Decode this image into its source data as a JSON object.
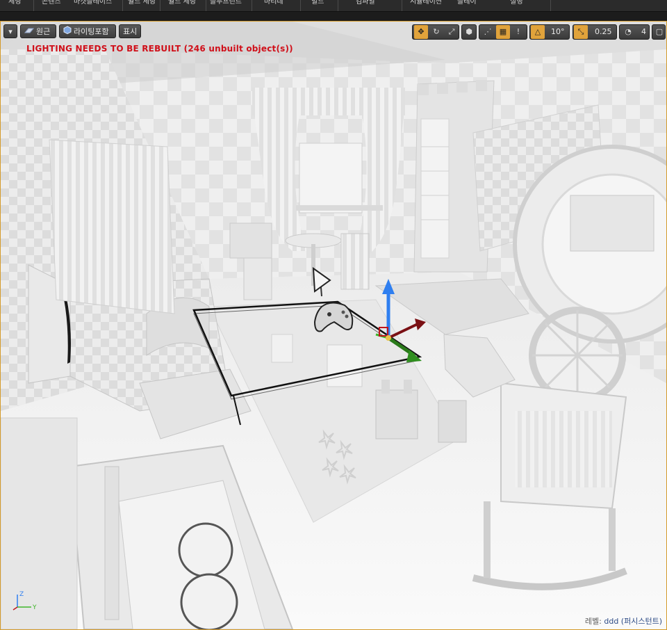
{
  "topbar": {
    "items": [
      "세팅",
      "콘텐츠",
      "마켓플레이스",
      "월드 세팅",
      "월드 세팅",
      "블루프린트",
      "마티네",
      "빌드",
      "컴파일",
      "시뮬레이션",
      "플레이",
      "실행"
    ]
  },
  "viewport": {
    "menu_label": "▾",
    "perspective_label": "원근",
    "lit_label": "라이팅포함",
    "show_label": "표시",
    "warning": "LIGHTING NEEDS TO BE REBUILT (246 unbuilt object(s))",
    "rotation_snap": "10°",
    "scale_snap": "0.25",
    "camera_speed": "4",
    "level_label": "레벨:",
    "level_name": "ddd (퍼시스턴트)",
    "axis_z": "Z",
    "axis_y": "Y"
  },
  "colors": {
    "accent": "#e1a33b",
    "warning": "#d0101a",
    "gizmo_z": "#2f7ff0",
    "gizmo_x": "#c0141a",
    "gizmo_y": "#3fb52a"
  }
}
